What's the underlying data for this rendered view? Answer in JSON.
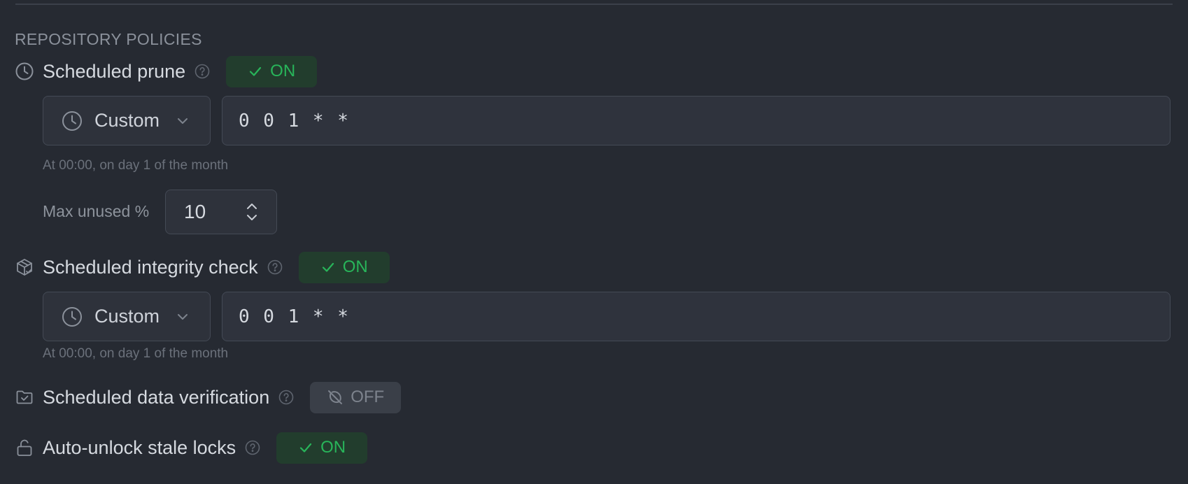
{
  "section": {
    "title": "REPOSITORY POLICIES"
  },
  "prune": {
    "label": "Scheduled prune",
    "toggle": {
      "state": "ON",
      "enabled": true
    },
    "schedule": {
      "mode": "Custom",
      "cron": "0 0 1 * *",
      "hint": "At 00:00, on day 1 of the month"
    },
    "max_unused": {
      "label": "Max unused %",
      "value": "10"
    }
  },
  "integrity": {
    "label": "Scheduled integrity check",
    "toggle": {
      "state": "ON",
      "enabled": true
    },
    "schedule": {
      "mode": "Custom",
      "cron": "0 0 1 * *",
      "hint": "At 00:00, on day 1 of the month"
    }
  },
  "verification": {
    "label": "Scheduled data verification",
    "toggle": {
      "state": "OFF",
      "enabled": false
    }
  },
  "unlock": {
    "label": "Auto-unlock stale locks",
    "toggle": {
      "state": "ON",
      "enabled": true
    }
  },
  "icons": {
    "prune": "clock-icon",
    "integrity": "package-check-icon",
    "verification": "folder-check-icon",
    "unlock": "lock-open-icon",
    "help": "question-circle-icon",
    "on": "check-icon",
    "off": "circle-off-icon",
    "select": "clock-icon",
    "dropdown": "chevron-down-icon",
    "stepper": "chevron-up-down-icon"
  },
  "colors": {
    "background": "#262a32",
    "on_bg": "#223d2d",
    "on_text": "#28b55a",
    "off_bg": "#3a3f48",
    "off_text": "#7d838d",
    "muted_text": "#8b919b"
  }
}
